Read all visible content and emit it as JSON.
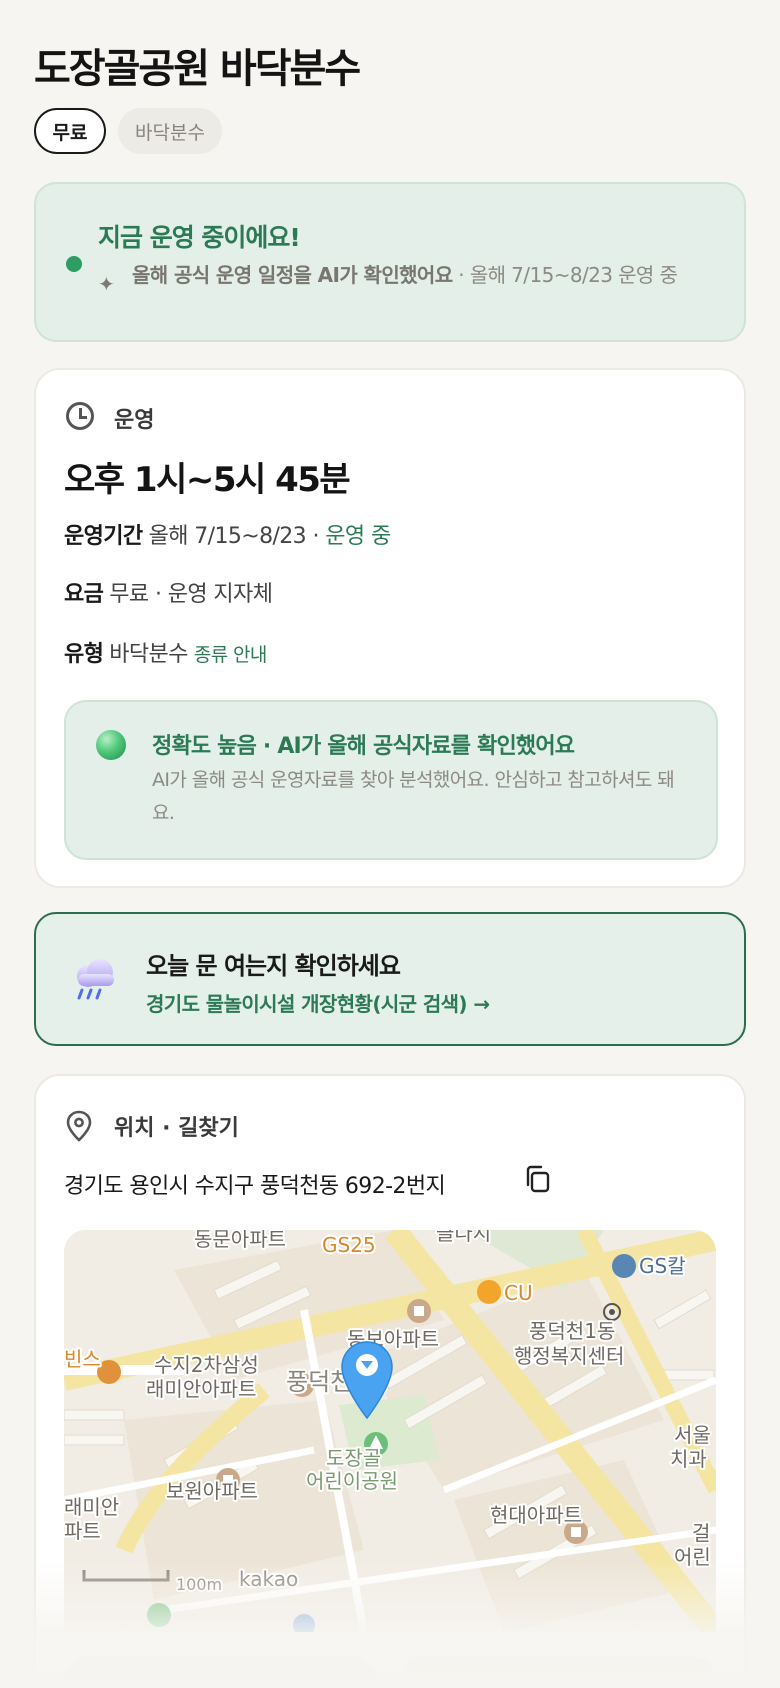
{
  "page": {
    "title": "도장골공원 바닥분수",
    "chips": {
      "price": "무료",
      "type": "바닥분수"
    }
  },
  "status": {
    "title": "지금 운영 중이에요!",
    "ai_note_bold": "올해 공식 운영 일정을 AI가 확인했어요",
    "ai_note_rest": " · 올해 7/15~8/23 운영 중",
    "sparkle_icon": "sparkle-icon"
  },
  "operation": {
    "label": "운영",
    "icon": "clock-icon",
    "hours": "오후 1시~5시 45분",
    "period_key": "운영기간",
    "period_value": "올해 7/15~8/23 ·",
    "period_status": "운영 중",
    "fee_key": "요금",
    "fee_value": "무료 · 운영 지자체",
    "type_key": "유형",
    "type_value": "바닥분수",
    "type_link": "종류 안내",
    "accuracy_title": "정확도 높음 · AI가 올해 공식자료를 확인했어요",
    "accuracy_text": "AI가 올해 공식 운영자료를 찾아 분석했어요. 안심하고 참고하셔도 돼요."
  },
  "open_check": {
    "icon": "rain-cloud-icon",
    "title": "오늘 문 여는지 확인하세요",
    "link": "경기도 물놀이시설 개장현황(시군 검색) →"
  },
  "location": {
    "label": "위치 · 길찾기",
    "icon": "location-pin-icon",
    "address": "경기도 용인시 수지구 풍덕천동 692-2번지",
    "copy_icon": "copy-icon",
    "map_labels": {
      "dongmun": "동문아파트",
      "gs25": "GS25",
      "top_cut": "클다지",
      "gs_station": "GS칼",
      "cu": "CU",
      "dongbo": "동보아파트",
      "center_line1": "풍덕천1동",
      "center_line2": "행정복지센터",
      "samsung_line1": "수지2차삼성",
      "samsung_line2": "래미안아파트",
      "district": "풍덕천2동",
      "park_line1": "도장골",
      "park_line2": "어린이공원",
      "bowon": "보원아파트",
      "hyundai": "현대아파트",
      "raemian_line1": "래미안",
      "raemian_line2": "파트",
      "seoul_line1": "서울",
      "seoul_line2": "치과",
      "right_cut1": "걸",
      "right_cut2": "어린",
      "cafe": "빈스",
      "scale": "100m",
      "brand": "kakao"
    },
    "colors": {
      "accent_green": "#2b7a54",
      "marker_blue": "#4aa3f0"
    }
  }
}
